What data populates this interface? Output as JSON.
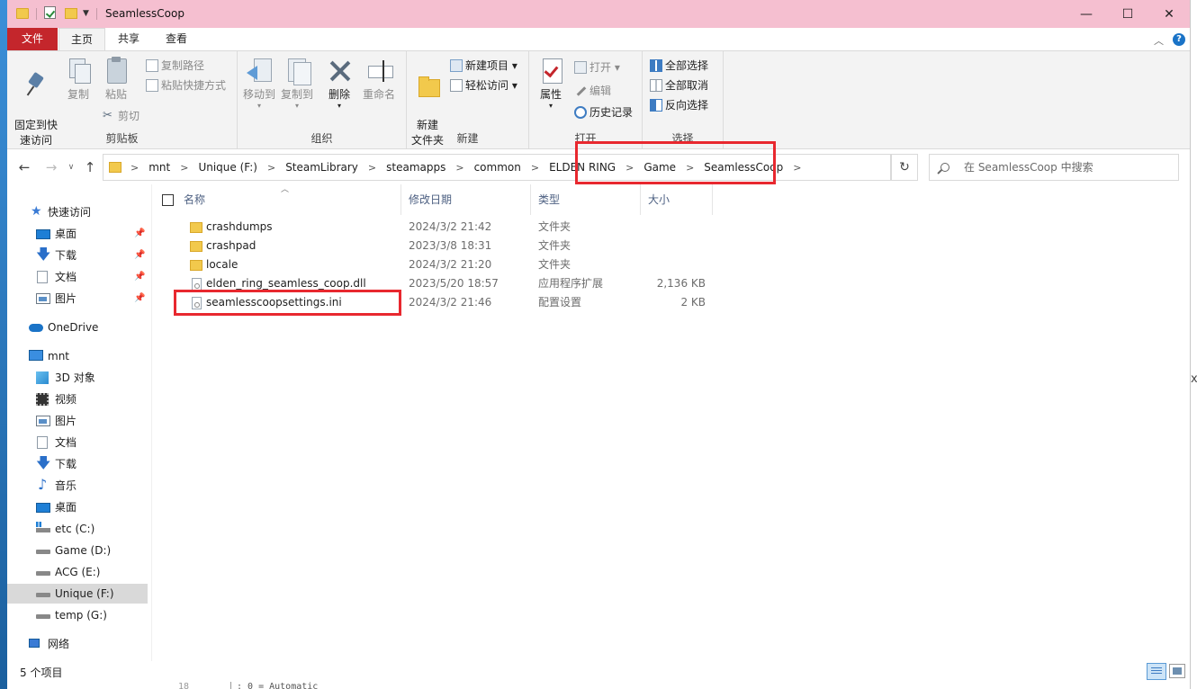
{
  "window": {
    "title": "SeamlessCoop",
    "minimize": "—",
    "maximize": "☐",
    "close": "✕"
  },
  "tabs": {
    "file": "文件",
    "home": "主页",
    "share": "共享",
    "view": "查看"
  },
  "ribbon": {
    "clipboard": {
      "label": "剪贴板",
      "pin": "固定到快\n速访问",
      "copy": "复制",
      "paste": "粘贴",
      "copy_path": "复制路径",
      "paste_shortcut": "粘贴快捷方式",
      "cut": "剪切"
    },
    "organize": {
      "label": "组织",
      "move_to": "移动到",
      "copy_to": "复制到",
      "delete": "删除",
      "rename": "重命名"
    },
    "new": {
      "label": "新建",
      "new_folder": "新建\n文件夹",
      "new_item": "新建项目 ▾",
      "easy_access": "轻松访问 ▾"
    },
    "open": {
      "label": "打开",
      "properties": "属性",
      "open": "打开 ▾",
      "edit": "编辑",
      "history": "历史记录"
    },
    "select": {
      "label": "选择",
      "select_all": "全部选择",
      "select_none": "全部取消",
      "invert": "反向选择"
    }
  },
  "address": {
    "crumbs": [
      "mnt",
      "Unique (F:)",
      "SteamLibrary",
      "steamapps",
      "common",
      "ELDEN RING",
      "Game",
      "SeamlessCoop"
    ],
    "search_placeholder": "在 SeamlessCoop 中搜索"
  },
  "nav": {
    "quick_access": "快速访问",
    "qa_items": [
      "桌面",
      "下载",
      "文档",
      "图片"
    ],
    "onedrive": "OneDrive",
    "pc": "mnt",
    "pc_items": [
      "3D 对象",
      "视频",
      "图片",
      "文档",
      "下载",
      "音乐",
      "桌面",
      "etc (C:)",
      "Game (D:)",
      "ACG (E:)",
      "Unique (F:)",
      "temp (G:)"
    ],
    "network": "网络"
  },
  "columns": {
    "name": "名称",
    "date": "修改日期",
    "type": "类型",
    "size": "大小"
  },
  "files": [
    {
      "name": "crashdumps",
      "date": "2024/3/2 21:42",
      "type": "文件夹",
      "size": "",
      "kind": "folder"
    },
    {
      "name": "crashpad",
      "date": "2023/3/8 18:31",
      "type": "文件夹",
      "size": "",
      "kind": "folder"
    },
    {
      "name": "locale",
      "date": "2024/3/2 21:20",
      "type": "文件夹",
      "size": "",
      "kind": "folder"
    },
    {
      "name": "elden_ring_seamless_coop.dll",
      "date": "2023/5/20 18:57",
      "type": "应用程序扩展",
      "size": "2,136 KB",
      "kind": "file"
    },
    {
      "name": "seamlesscoopsettings.ini",
      "date": "2024/3/2 21:46",
      "type": "配置设置",
      "size": "2 KB",
      "kind": "file"
    }
  ],
  "status": {
    "count": "5 个项目"
  },
  "background": {
    "line_number": "18",
    "code": "; 0 = Automatic"
  },
  "colors": {
    "titlebar": "#f5bfd0",
    "file_tab": "#c4262c",
    "highlight": "#e8282f",
    "folder": "#f2c94c"
  }
}
